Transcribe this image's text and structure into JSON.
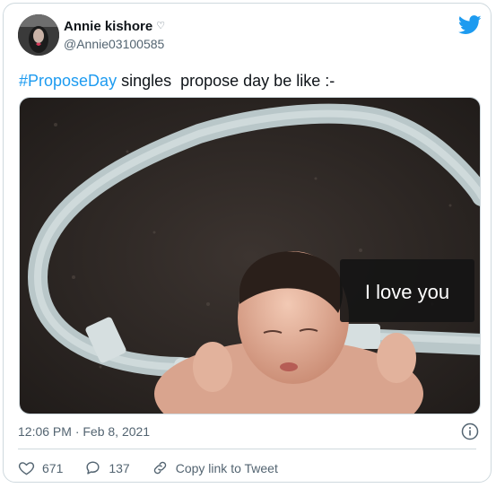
{
  "user": {
    "display_name": "Annie kishore",
    "handle": "@Annie03100585",
    "badge_icon": "heart-outline-icon"
  },
  "platform_icon": "twitter-bird-icon",
  "tweet": {
    "hashtag": "#ProposeDay",
    "text": " singles  propose day be like :-"
  },
  "media": {
    "caption_overlay": "I love you"
  },
  "meta": {
    "timestamp": "12:06 PM · Feb 8, 2021"
  },
  "actions": {
    "like_count": "671",
    "reply_count": "137",
    "copy_link_label": "Copy link to Tweet"
  },
  "colors": {
    "accent": "#1d9bf0",
    "muted": "#536471",
    "border": "#cfd9de"
  }
}
